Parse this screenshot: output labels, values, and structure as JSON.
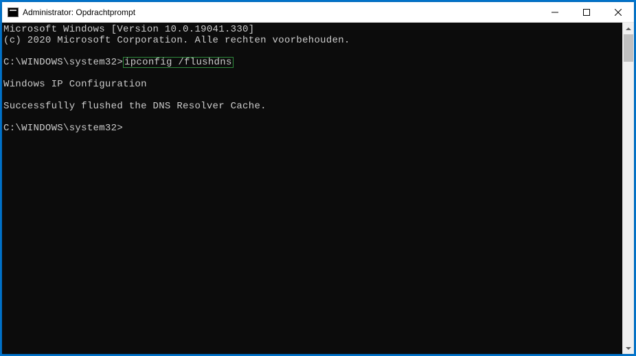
{
  "window": {
    "title": "Administrator: Opdrachtprompt"
  },
  "terminal": {
    "line1": "Microsoft Windows [Version 10.0.19041.330]",
    "line2": "(c) 2020 Microsoft Corporation. Alle rechten voorbehouden.",
    "blank1": "",
    "prompt1_path": "C:\\WINDOWS\\system32>",
    "prompt1_cmd": "ipconfig /flushdns",
    "blank2": "",
    "line3": "Windows IP Configuration",
    "blank3": "",
    "line4": "Successfully flushed the DNS Resolver Cache.",
    "blank4": "",
    "prompt2": "C:\\WINDOWS\\system32>"
  }
}
